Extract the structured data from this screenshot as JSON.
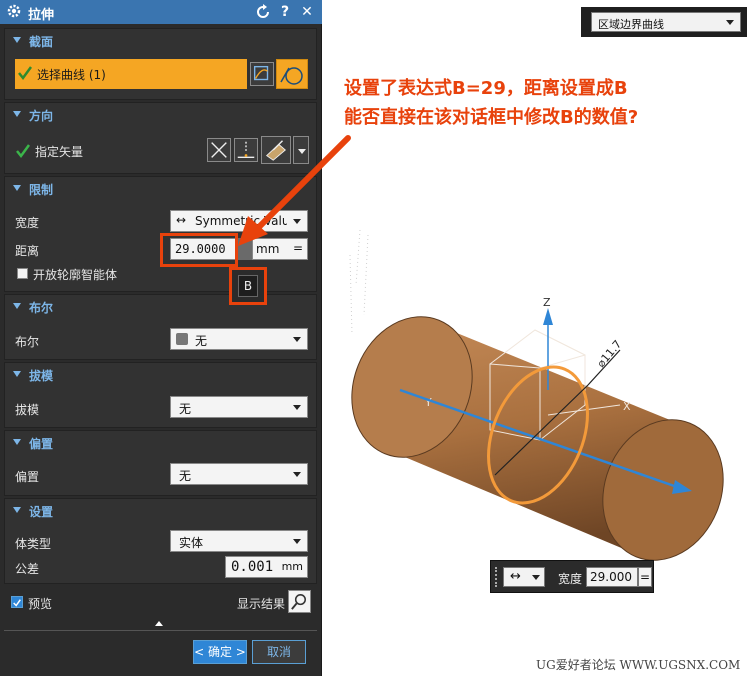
{
  "dialog": {
    "title": "拉伸",
    "reset_icon": "reset-icon",
    "help_label": "?",
    "close_label": "✕",
    "section_profile": {
      "header": "截面",
      "select_curve": "选择曲线 (1)"
    },
    "section_direction": {
      "header": "方向",
      "specify_vector": "指定矢量"
    },
    "section_limits": {
      "header": "限制",
      "width_label": "宽度",
      "width_value": "Symmetric Value",
      "distance_label": "距离",
      "distance_value": "29.0000",
      "distance_unit": "mm",
      "distance_eq": "=",
      "open_profile_label": "开放轮廓智能体",
      "expression_tooltip": "B"
    },
    "section_boolean": {
      "header": "布尔",
      "label": "布尔",
      "value": "无"
    },
    "section_draft": {
      "header": "拔模",
      "label": "拔模",
      "value": "无"
    },
    "section_offset": {
      "header": "偏置",
      "label": "偏置",
      "value": "无"
    },
    "section_settings": {
      "header": "设置",
      "body_type_label": "体类型",
      "body_type_value": "实体",
      "tolerance_label": "公差",
      "tolerance_value": "0.001",
      "tolerance_unit": "mm"
    },
    "preview_label": "预览",
    "show_result_label": "显示结果",
    "ok_label": "< 确定 >",
    "cancel_label": "取消"
  },
  "viewport": {
    "boundary_dropdown": "区域边界曲线",
    "annotation_line1": "设置了表达式B=29，距离设置成B",
    "annotation_line2": "能否直接在该对话框中修改B的数值?",
    "axis_z": "Z",
    "axis_x": "X",
    "axis_y": "Y",
    "diameter_label": "⌀11.7",
    "float_width_label": "宽度",
    "float_width_value": "29.000",
    "float_eq": "=",
    "watermark": "UG爱好者论坛 WWW.UGSNX.COM"
  },
  "colors": {
    "title_bar": "#3a75b0",
    "section_header": "#7db6e8",
    "selection_highlight": "#f5a623",
    "annotation_red": "#e8420c",
    "cylinder": "#b0794a",
    "ring": "#f39a3a",
    "axis_blue": "#2f86d6"
  }
}
